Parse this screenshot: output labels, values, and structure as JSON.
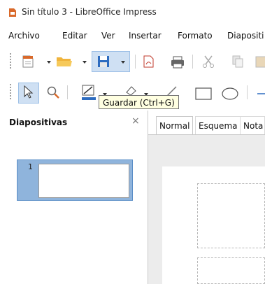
{
  "window": {
    "title": "Sin título 3 - LibreOffice Impress"
  },
  "menu": [
    "Archivo",
    "Editar",
    "Ver",
    "Insertar",
    "Formato",
    "Diapositi"
  ],
  "toolbar": {
    "tooltip": "Guardar (Ctrl+G)"
  },
  "colors": {
    "accent": "#2d6cc0",
    "slide_selected": "#8fb4dc",
    "tooltip_bg": "#ffffe1"
  },
  "slides_pane": {
    "title": "Diapositivas",
    "close": "×",
    "slides": [
      {
        "number": "1"
      }
    ]
  },
  "main": {
    "tabs": [
      "Normal",
      "Esquema",
      "Nota"
    ]
  }
}
